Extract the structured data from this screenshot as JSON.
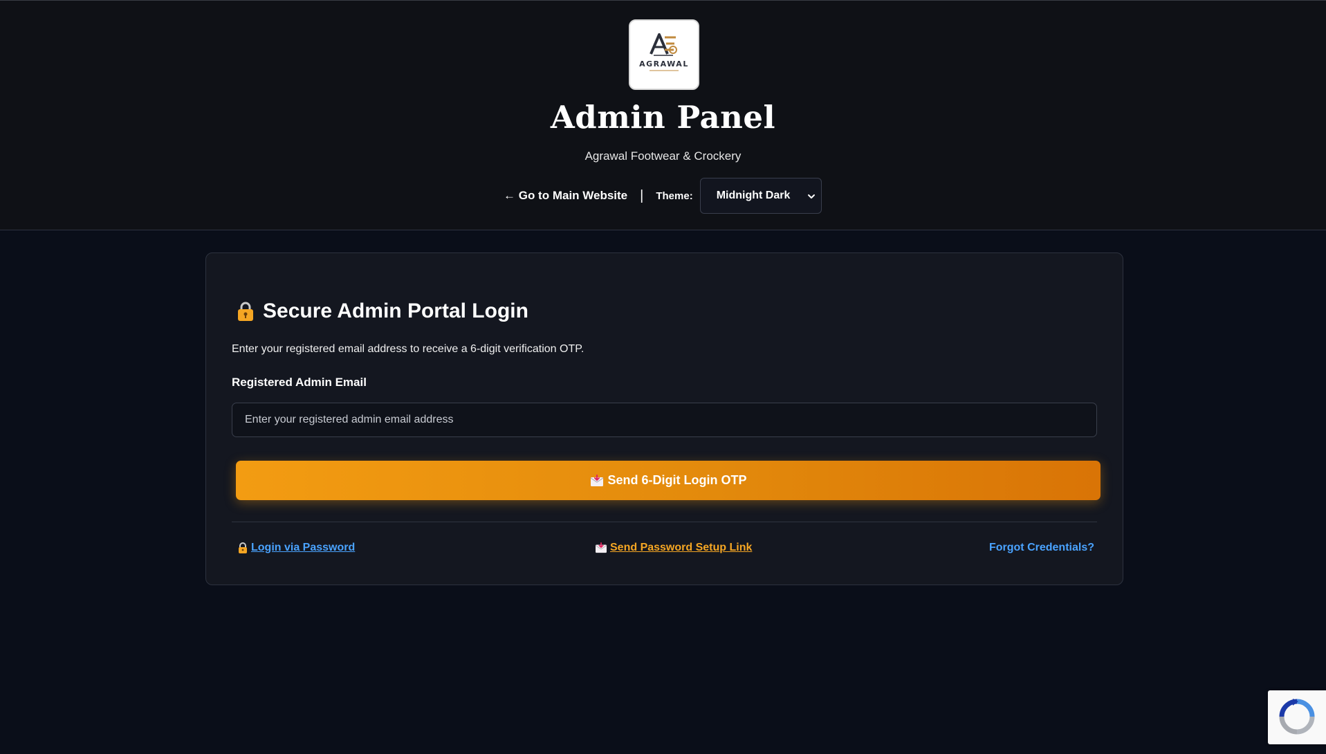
{
  "header": {
    "logo_text": "AGRAWAL",
    "title": "Admin Panel",
    "subtitle": "Agrawal Footwear & Crockery",
    "main_link": "← Go to Main Website",
    "separator": "|",
    "theme_label": "Theme:",
    "theme_value": "Midnight Dark"
  },
  "card": {
    "title": "Secure Admin Portal Login",
    "description": "Enter your registered email address to receive a 6-digit verification OTP.",
    "email_label": "Registered Admin Email",
    "email_placeholder": "Enter your registered admin email address",
    "email_value": "",
    "otp_button": "Send 6-Digit Login OTP",
    "links": {
      "password": "Login via Password",
      "setup": "Send Password Setup Link",
      "forgot": "Forgot Credentials?"
    }
  },
  "icons": {
    "title": "lock-icon",
    "otp_button": "envelope-icon",
    "password_link": "lock-icon",
    "setup_link": "envelope-icon",
    "theme_select": "chevron-down-icon",
    "badge": "recaptcha-icon"
  },
  "colors": {
    "background": "#0a0e19",
    "header": "#0f1116",
    "card": "#141720",
    "accent_orange": "#f39c12",
    "link_blue": "#4aa3ff",
    "link_orange": "#f5a623"
  }
}
